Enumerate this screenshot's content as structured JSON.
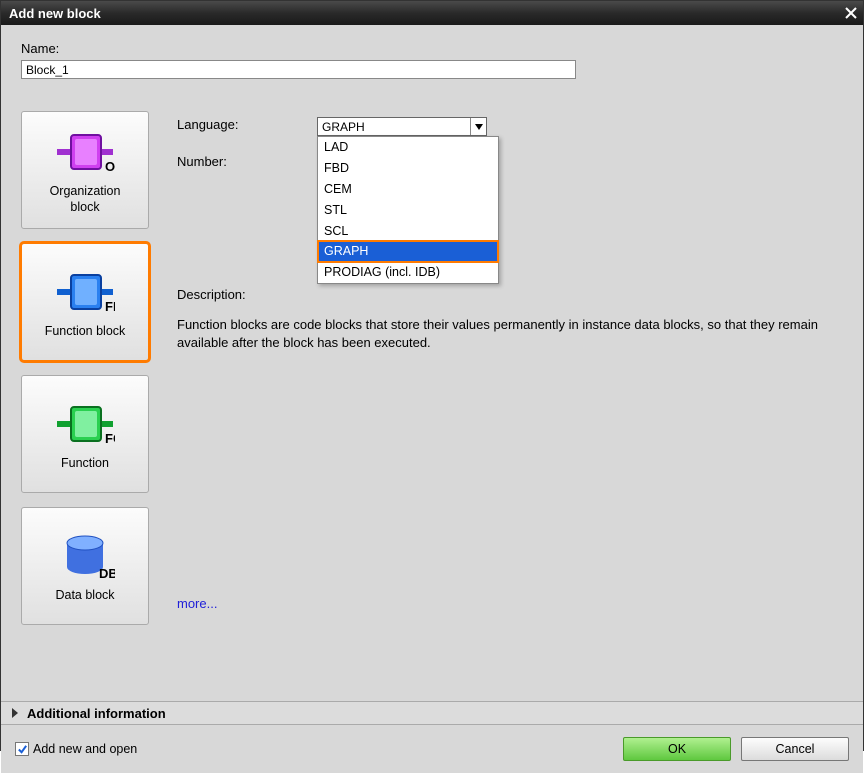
{
  "title": "Add new block",
  "name_label": "Name:",
  "name_value": "Block_1",
  "block_types": [
    {
      "label": "Organization\nblock",
      "tag": "OB"
    },
    {
      "label": "Function block",
      "tag": "FB"
    },
    {
      "label": "Function",
      "tag": "FC"
    },
    {
      "label": "Data block",
      "tag": "DB"
    }
  ],
  "language_label": "Language:",
  "language_value": "GRAPH",
  "number_label": "Number:",
  "language_options": [
    "LAD",
    "FBD",
    "CEM",
    "STL",
    "SCL",
    "GRAPH",
    "PRODIAG (incl. IDB)"
  ],
  "desc_label": "Description:",
  "desc_text": "Function blocks are code blocks that store their values permanently in instance data blocks, so that they remain available after the block has been executed.",
  "more": "more...",
  "additional_info": "Additional information",
  "add_open": "Add new and open",
  "ok": "OK",
  "cancel": "Cancel"
}
